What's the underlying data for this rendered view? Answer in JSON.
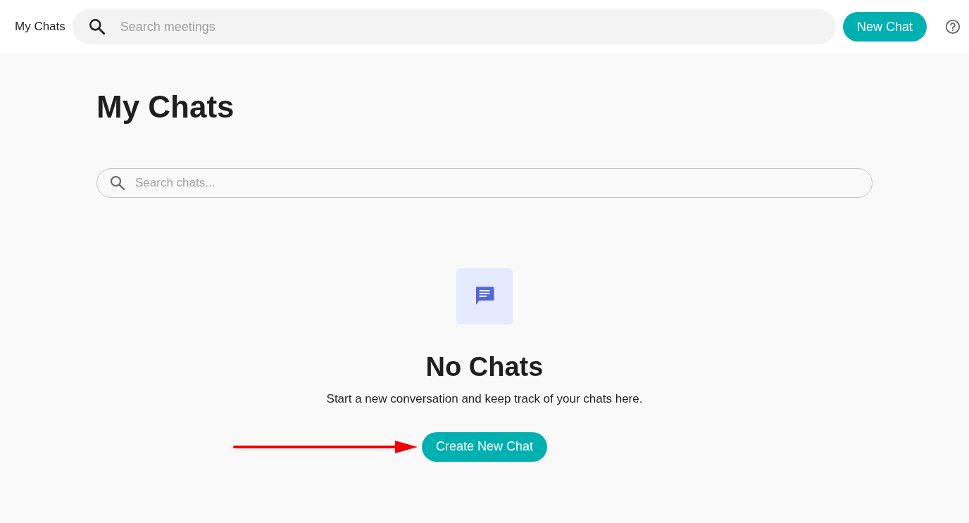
{
  "header": {
    "title": "My Chats",
    "search": {
      "placeholder": "Search meetings"
    },
    "new_chat_button": "New Chat"
  },
  "page": {
    "title": "My Chats",
    "search": {
      "placeholder": "Search chats..."
    }
  },
  "empty_state": {
    "title": "No Chats",
    "message": "Start a new conversation and keep track of your chats here.",
    "button": "Create New Chat"
  }
}
